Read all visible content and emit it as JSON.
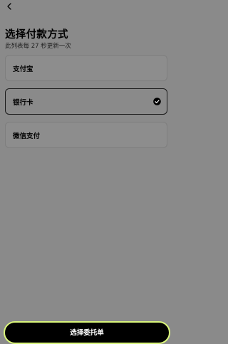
{
  "header": {
    "back_icon": "chevron-left-icon",
    "title": "选择付款方式",
    "subtitle": "此列表每 27 秒更新一次"
  },
  "payment_methods": [
    {
      "label": "支付宝",
      "selected": false
    },
    {
      "label": "银行卡",
      "selected": true
    },
    {
      "label": "微信支付",
      "selected": false
    }
  ],
  "selected_icon": "check-circle-icon",
  "footer": {
    "confirm_label": "选择委托单"
  },
  "colors": {
    "background": "#8a8a8a",
    "button_bg": "#000000",
    "button_border": "#d9f57a",
    "text": "#000000"
  }
}
